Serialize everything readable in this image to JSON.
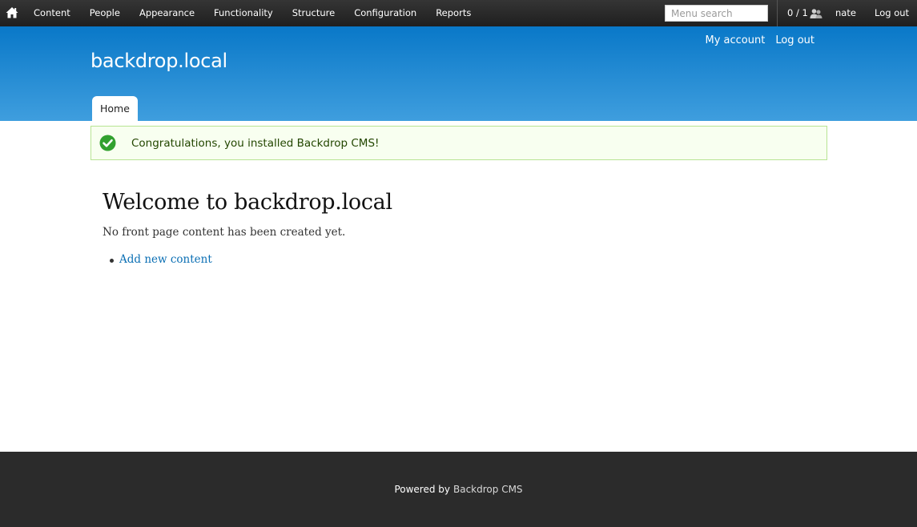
{
  "admin_bar": {
    "home_icon": "home-icon",
    "menu": [
      "Content",
      "People",
      "Appearance",
      "Functionality",
      "Structure",
      "Configuration",
      "Reports"
    ],
    "search_placeholder": "Menu search",
    "users_count": "0 / 1",
    "users_icon": "users-icon",
    "username": "nate",
    "logout": "Log out"
  },
  "header": {
    "site_name": "backdrop.local",
    "user_menu": [
      "My account",
      "Log out"
    ],
    "tabs": [
      "Home"
    ]
  },
  "status": {
    "icon": "check-icon",
    "message": "Congratulations, you installed Backdrop CMS!"
  },
  "main": {
    "title": "Welcome to backdrop.local",
    "intro": "No front page content has been created yet.",
    "links": [
      "Add new content"
    ]
  },
  "footer": {
    "powered_by": "Powered by",
    "cms_link": "Backdrop CMS"
  },
  "colors": {
    "admin_bar": "#262626",
    "header_top": "#0978c8",
    "header_bottom": "#3f9ede",
    "status_bg": "#f8fff0",
    "status_border": "#b7e493",
    "link": "#0b6fb4",
    "footer": "#2b2b2b"
  }
}
